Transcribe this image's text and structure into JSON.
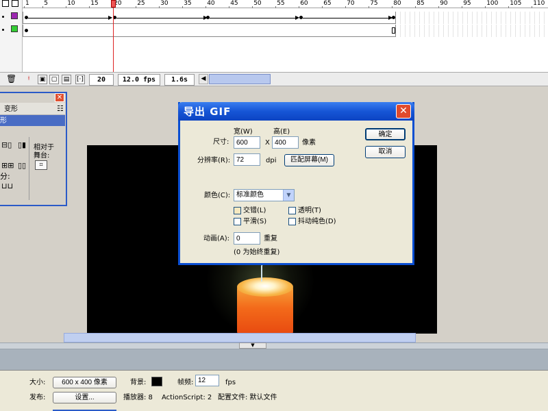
{
  "timeline": {
    "ruler_ticks": [
      "1",
      "5",
      "10",
      "15",
      "20",
      "25",
      "30",
      "35",
      "40",
      "45",
      "50",
      "55",
      "60",
      "65",
      "70",
      "75",
      "80",
      "85",
      "90",
      "95",
      "100",
      "105",
      "110"
    ],
    "layers": [
      {
        "swatch_color": "#9c27b0"
      },
      {
        "swatch_color": "#33cc33"
      }
    ],
    "current_frame": "20",
    "fps": "12.0 fps",
    "elapsed": "1.6s"
  },
  "panel": {
    "title": "变形",
    "sub_title": "形",
    "relative_label_1": "相对于",
    "relative_label_2": "舞台:",
    "colon_left": "分:"
  },
  "dialog": {
    "title": "导出 GIF",
    "size_label": "尺寸:",
    "width_label": "宽(W)",
    "height_label": "高(E)",
    "width_value": "600",
    "height_value": "400",
    "x_sep": "X",
    "pixels_unit": "像素",
    "resolution_label": "分辨率(R):",
    "resolution_value": "72",
    "dpi_unit": "dpi",
    "match_screen_button": "匹配屏幕(M)",
    "ok_button": "确定",
    "cancel_button": "取消",
    "colors_label": "颜色(C):",
    "colors_value": "标准颜色",
    "interlace_label": "交错(L)",
    "transparent_label": "透明(T)",
    "smooth_label": "平滑(S)",
    "dither_label": "抖动纯色(D)",
    "animation_label": "动画(A):",
    "animation_value": "0",
    "repeat_label": "重复",
    "repeat_hint": "(0 为始终重复)"
  },
  "properties": {
    "size_label": "大小:",
    "size_button": "600 x 400 像素",
    "background_label": "背景:",
    "background_color": "#000000",
    "framerate_label": "帧频:",
    "framerate_value": "12",
    "fps_unit": "fps",
    "publish_label": "发布:",
    "settings_button": "设置...",
    "player_label": "播放器: 8",
    "actionscript_label": "ActionScript: 2",
    "profile_label": "配置文件: 默认文件"
  },
  "colors": {
    "stage": "#000000",
    "dialog_title": "#0c43c2",
    "playhead": "#dd2222"
  }
}
